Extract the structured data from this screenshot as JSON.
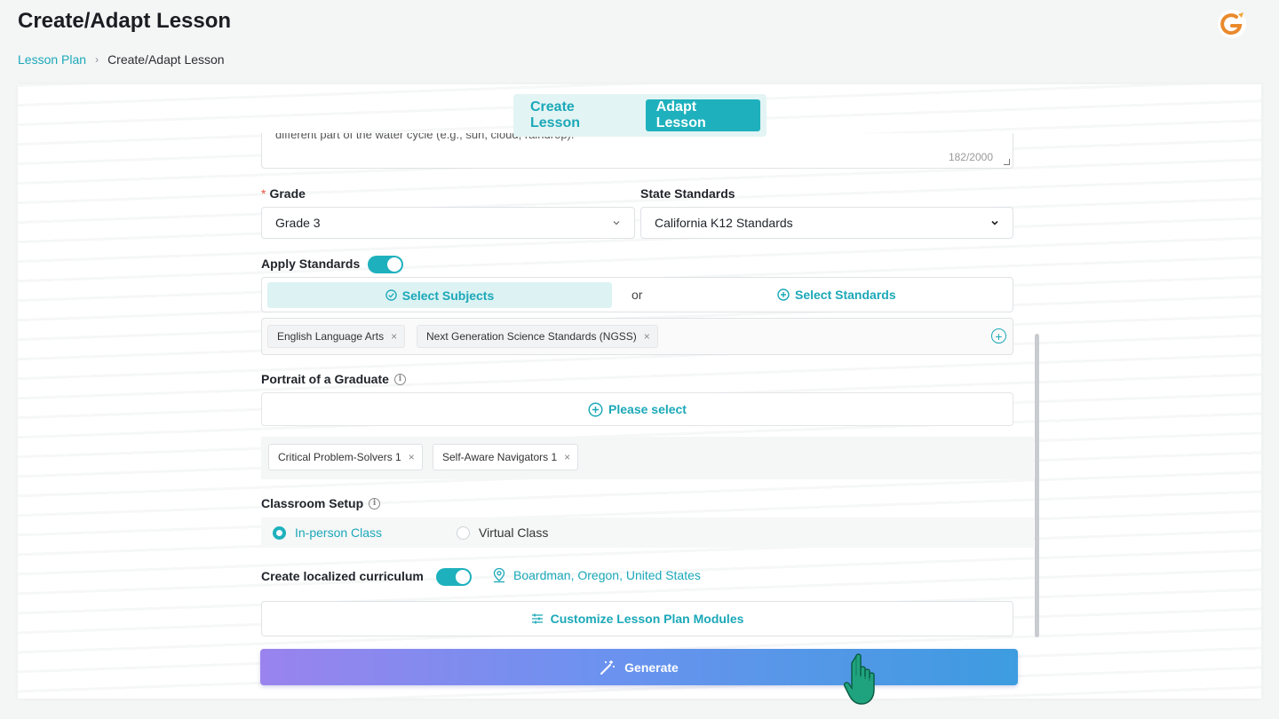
{
  "header": {
    "title": "Create/Adapt Lesson",
    "breadcrumb": [
      {
        "label": "Lesson Plan"
      },
      {
        "label": "Create/Adapt Lesson"
      }
    ]
  },
  "mode_switch": {
    "tabs": [
      {
        "label": "Create Lesson",
        "active": false
      },
      {
        "label": "Adapt Lesson",
        "active": true
      }
    ]
  },
  "description": {
    "visible_text": "different part of the water cycle (e.g., sun, cloud, raindrop).",
    "char_count": "182/2000"
  },
  "grade": {
    "required_mark": "*",
    "label": "Grade",
    "value": "Grade 3"
  },
  "state_standards": {
    "label": "State Standards",
    "value": "California K12 Standards"
  },
  "apply_standards": {
    "label": "Apply Standards",
    "enabled": true,
    "select_subjects": "Select Subjects",
    "or": "or",
    "select_standards": "Select Standards",
    "tags": [
      "English Language Arts",
      "Next Generation Science Standards (NGSS)"
    ]
  },
  "portrait_of_graduate": {
    "label": "Portrait of a Graduate",
    "please_select": "Please select",
    "tags": [
      "Critical Problem-Solvers 1",
      "Self-Aware Navigators 1"
    ]
  },
  "classroom_setup": {
    "label": "Classroom Setup",
    "options": [
      {
        "label": "In-person Class",
        "selected": true
      },
      {
        "label": "Virtual Class",
        "selected": false
      }
    ]
  },
  "localized": {
    "label": "Create localized curriculum",
    "enabled": true,
    "location": "Boardman, Oregon, United States"
  },
  "customize_button": "Customize Lesson Plan Modules",
  "generate_button": "Generate",
  "colors": {
    "accent": "#1eb1bd",
    "generate_start": "#9a83ee",
    "generate_end": "#3d9ce0",
    "required": "#e5533c"
  }
}
